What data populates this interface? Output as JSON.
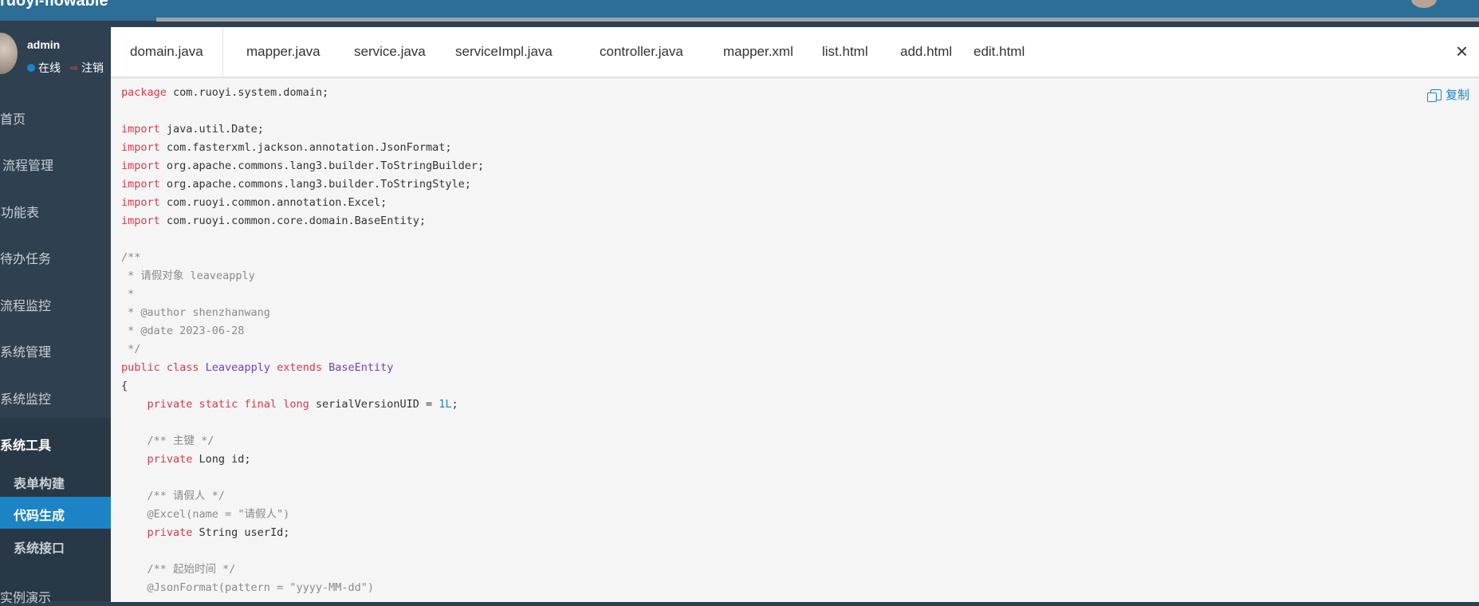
{
  "header": {
    "brand": "ruoyi-flowable",
    "right_items": [
      "",
      "",
      ""
    ]
  },
  "sidebar": {
    "user": {
      "name": "admin",
      "status": "在线",
      "logout": "注销"
    },
    "items": [
      {
        "label": "首页"
      },
      {
        "label": "流程管理"
      },
      {
        "label": "功能表"
      },
      {
        "label": "待办任务"
      },
      {
        "label": "流程监控"
      },
      {
        "label": "系统管理"
      },
      {
        "label": "系统监控"
      },
      {
        "label": "系统工具"
      }
    ],
    "sub_items": [
      {
        "label": "表单构建"
      },
      {
        "label": "代码生成"
      },
      {
        "label": "系统接口"
      }
    ],
    "last_item": "实例演示"
  },
  "modal": {
    "tabs": [
      {
        "label": "domain.java"
      },
      {
        "label": "mapper.java"
      },
      {
        "label": "service.java"
      },
      {
        "label": "serviceImpl.java"
      },
      {
        "label": "controller.java"
      },
      {
        "label": "mapper.xml"
      },
      {
        "label": "list.html"
      },
      {
        "label": "add.html"
      },
      {
        "label": "edit.html"
      }
    ],
    "close": "×",
    "copy_label": "复制"
  },
  "code": {
    "l1": {
      "kw": "package",
      "rest": " com.ruoyi.system.domain;"
    },
    "l3": {
      "kw": "import",
      "rest": " java.util.Date;"
    },
    "l4": {
      "kw": "import",
      "rest": " com.fasterxml.jackson.annotation.JsonFormat;"
    },
    "l5": {
      "kw": "import",
      "rest": " org.apache.commons.lang3.builder.ToStringBuilder;"
    },
    "l6": {
      "kw": "import",
      "rest": " org.apache.commons.lang3.builder.ToStringStyle;"
    },
    "l7": {
      "kw": "import",
      "rest": " com.ruoyi.common.annotation.Excel;"
    },
    "l8": {
      "kw": "import",
      "rest": " com.ruoyi.common.core.domain.BaseEntity;"
    },
    "l10": "/**",
    "l11": " * 请假对象 leaveapply",
    "l12": " *",
    "l13": " * @author shenzhanwang",
    "l14": " * @date 2023-06-28",
    "l15": " */",
    "l16": {
      "kw1": "public class ",
      "cls": "Leaveapply",
      "kw2": " extends ",
      "base": "BaseEntity"
    },
    "l17": "{",
    "l18": {
      "kw": "    private static final long",
      "rest": " serialVersionUID = ",
      "num": "1L",
      "end": ";"
    },
    "l20": "    /** 主键 */",
    "l21": {
      "kw": "    private",
      "rest": " Long id;"
    },
    "l23": "    /** 请假人 */",
    "l24a": "    @Excel(name = ",
    "l24b": "\"请假人\"",
    "l24c": ")",
    "l25": {
      "kw": "    private",
      "rest": " String userId;"
    },
    "l27": "    /** 起始时间 */",
    "l28a": "    @JsonFormat(pattern = ",
    "l28b": "\"yyyy-MM-dd\"",
    "l28c": ")"
  }
}
